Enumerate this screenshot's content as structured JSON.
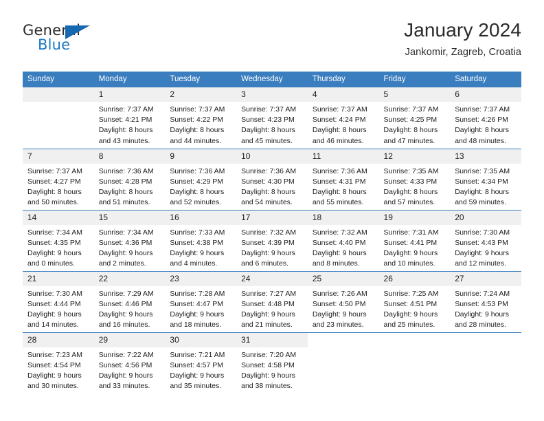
{
  "brand": {
    "name_part1": "General",
    "name_part2": "Blue",
    "flag_icon": "blue-triangle-flag-icon",
    "accent_color": "#1b79c4"
  },
  "header": {
    "title": "January 2024",
    "location": "Jankomir, Zagreb, Croatia"
  },
  "theme": {
    "header_blue": "#3a7ebf",
    "daynum_band": "#f0f0f0",
    "text": "#1c1c1c"
  },
  "weekday_headers": [
    "Sunday",
    "Monday",
    "Tuesday",
    "Wednesday",
    "Thursday",
    "Friday",
    "Saturday"
  ],
  "weeks": [
    [
      {
        "day": "",
        "sunrise": "",
        "sunset": "",
        "daylight_1": "",
        "daylight_2": "",
        "empty": true
      },
      {
        "day": "1",
        "sunrise": "Sunrise: 7:37 AM",
        "sunset": "Sunset: 4:21 PM",
        "daylight_1": "Daylight: 8 hours",
        "daylight_2": "and 43 minutes."
      },
      {
        "day": "2",
        "sunrise": "Sunrise: 7:37 AM",
        "sunset": "Sunset: 4:22 PM",
        "daylight_1": "Daylight: 8 hours",
        "daylight_2": "and 44 minutes."
      },
      {
        "day": "3",
        "sunrise": "Sunrise: 7:37 AM",
        "sunset": "Sunset: 4:23 PM",
        "daylight_1": "Daylight: 8 hours",
        "daylight_2": "and 45 minutes."
      },
      {
        "day": "4",
        "sunrise": "Sunrise: 7:37 AM",
        "sunset": "Sunset: 4:24 PM",
        "daylight_1": "Daylight: 8 hours",
        "daylight_2": "and 46 minutes."
      },
      {
        "day": "5",
        "sunrise": "Sunrise: 7:37 AM",
        "sunset": "Sunset: 4:25 PM",
        "daylight_1": "Daylight: 8 hours",
        "daylight_2": "and 47 minutes."
      },
      {
        "day": "6",
        "sunrise": "Sunrise: 7:37 AM",
        "sunset": "Sunset: 4:26 PM",
        "daylight_1": "Daylight: 8 hours",
        "daylight_2": "and 48 minutes."
      }
    ],
    [
      {
        "day": "7",
        "sunrise": "Sunrise: 7:37 AM",
        "sunset": "Sunset: 4:27 PM",
        "daylight_1": "Daylight: 8 hours",
        "daylight_2": "and 50 minutes."
      },
      {
        "day": "8",
        "sunrise": "Sunrise: 7:36 AM",
        "sunset": "Sunset: 4:28 PM",
        "daylight_1": "Daylight: 8 hours",
        "daylight_2": "and 51 minutes."
      },
      {
        "day": "9",
        "sunrise": "Sunrise: 7:36 AM",
        "sunset": "Sunset: 4:29 PM",
        "daylight_1": "Daylight: 8 hours",
        "daylight_2": "and 52 minutes."
      },
      {
        "day": "10",
        "sunrise": "Sunrise: 7:36 AM",
        "sunset": "Sunset: 4:30 PM",
        "daylight_1": "Daylight: 8 hours",
        "daylight_2": "and 54 minutes."
      },
      {
        "day": "11",
        "sunrise": "Sunrise: 7:36 AM",
        "sunset": "Sunset: 4:31 PM",
        "daylight_1": "Daylight: 8 hours",
        "daylight_2": "and 55 minutes."
      },
      {
        "day": "12",
        "sunrise": "Sunrise: 7:35 AM",
        "sunset": "Sunset: 4:33 PM",
        "daylight_1": "Daylight: 8 hours",
        "daylight_2": "and 57 minutes."
      },
      {
        "day": "13",
        "sunrise": "Sunrise: 7:35 AM",
        "sunset": "Sunset: 4:34 PM",
        "daylight_1": "Daylight: 8 hours",
        "daylight_2": "and 59 minutes."
      }
    ],
    [
      {
        "day": "14",
        "sunrise": "Sunrise: 7:34 AM",
        "sunset": "Sunset: 4:35 PM",
        "daylight_1": "Daylight: 9 hours",
        "daylight_2": "and 0 minutes."
      },
      {
        "day": "15",
        "sunrise": "Sunrise: 7:34 AM",
        "sunset": "Sunset: 4:36 PM",
        "daylight_1": "Daylight: 9 hours",
        "daylight_2": "and 2 minutes."
      },
      {
        "day": "16",
        "sunrise": "Sunrise: 7:33 AM",
        "sunset": "Sunset: 4:38 PM",
        "daylight_1": "Daylight: 9 hours",
        "daylight_2": "and 4 minutes."
      },
      {
        "day": "17",
        "sunrise": "Sunrise: 7:32 AM",
        "sunset": "Sunset: 4:39 PM",
        "daylight_1": "Daylight: 9 hours",
        "daylight_2": "and 6 minutes."
      },
      {
        "day": "18",
        "sunrise": "Sunrise: 7:32 AM",
        "sunset": "Sunset: 4:40 PM",
        "daylight_1": "Daylight: 9 hours",
        "daylight_2": "and 8 minutes."
      },
      {
        "day": "19",
        "sunrise": "Sunrise: 7:31 AM",
        "sunset": "Sunset: 4:41 PM",
        "daylight_1": "Daylight: 9 hours",
        "daylight_2": "and 10 minutes."
      },
      {
        "day": "20",
        "sunrise": "Sunrise: 7:30 AM",
        "sunset": "Sunset: 4:43 PM",
        "daylight_1": "Daylight: 9 hours",
        "daylight_2": "and 12 minutes."
      }
    ],
    [
      {
        "day": "21",
        "sunrise": "Sunrise: 7:30 AM",
        "sunset": "Sunset: 4:44 PM",
        "daylight_1": "Daylight: 9 hours",
        "daylight_2": "and 14 minutes."
      },
      {
        "day": "22",
        "sunrise": "Sunrise: 7:29 AM",
        "sunset": "Sunset: 4:46 PM",
        "daylight_1": "Daylight: 9 hours",
        "daylight_2": "and 16 minutes."
      },
      {
        "day": "23",
        "sunrise": "Sunrise: 7:28 AM",
        "sunset": "Sunset: 4:47 PM",
        "daylight_1": "Daylight: 9 hours",
        "daylight_2": "and 18 minutes."
      },
      {
        "day": "24",
        "sunrise": "Sunrise: 7:27 AM",
        "sunset": "Sunset: 4:48 PM",
        "daylight_1": "Daylight: 9 hours",
        "daylight_2": "and 21 minutes."
      },
      {
        "day": "25",
        "sunrise": "Sunrise: 7:26 AM",
        "sunset": "Sunset: 4:50 PM",
        "daylight_1": "Daylight: 9 hours",
        "daylight_2": "and 23 minutes."
      },
      {
        "day": "26",
        "sunrise": "Sunrise: 7:25 AM",
        "sunset": "Sunset: 4:51 PM",
        "daylight_1": "Daylight: 9 hours",
        "daylight_2": "and 25 minutes."
      },
      {
        "day": "27",
        "sunrise": "Sunrise: 7:24 AM",
        "sunset": "Sunset: 4:53 PM",
        "daylight_1": "Daylight: 9 hours",
        "daylight_2": "and 28 minutes."
      }
    ],
    [
      {
        "day": "28",
        "sunrise": "Sunrise: 7:23 AM",
        "sunset": "Sunset: 4:54 PM",
        "daylight_1": "Daylight: 9 hours",
        "daylight_2": "and 30 minutes."
      },
      {
        "day": "29",
        "sunrise": "Sunrise: 7:22 AM",
        "sunset": "Sunset: 4:56 PM",
        "daylight_1": "Daylight: 9 hours",
        "daylight_2": "and 33 minutes."
      },
      {
        "day": "30",
        "sunrise": "Sunrise: 7:21 AM",
        "sunset": "Sunset: 4:57 PM",
        "daylight_1": "Daylight: 9 hours",
        "daylight_2": "and 35 minutes."
      },
      {
        "day": "31",
        "sunrise": "Sunrise: 7:20 AM",
        "sunset": "Sunset: 4:58 PM",
        "daylight_1": "Daylight: 9 hours",
        "daylight_2": "and 38 minutes."
      },
      {
        "day": "",
        "sunrise": "",
        "sunset": "",
        "daylight_1": "",
        "daylight_2": "",
        "nodata": true
      },
      {
        "day": "",
        "sunrise": "",
        "sunset": "",
        "daylight_1": "",
        "daylight_2": "",
        "nodata": true
      },
      {
        "day": "",
        "sunrise": "",
        "sunset": "",
        "daylight_1": "",
        "daylight_2": "",
        "nodata": true
      }
    ]
  ]
}
